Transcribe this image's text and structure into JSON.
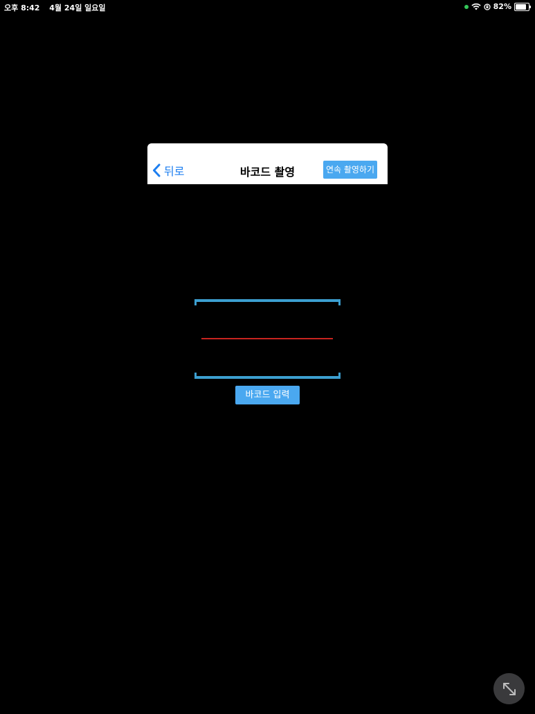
{
  "status_bar": {
    "time": "오후 8:42",
    "date": "4월 24일 일요일",
    "battery_percent": "82%",
    "battery_level": 0.82
  },
  "navbar": {
    "back_label": "뒤로",
    "title": "바코드 촬영",
    "continuous_label": "연속 촬영하기"
  },
  "scanner": {
    "barcode_input_label": "바코드 입력"
  },
  "colors": {
    "accent_blue": "#1c7ef0",
    "button_blue": "#4aa8f0",
    "frame_blue": "#3c9fd0",
    "scan_line_red": "#c8241f"
  }
}
